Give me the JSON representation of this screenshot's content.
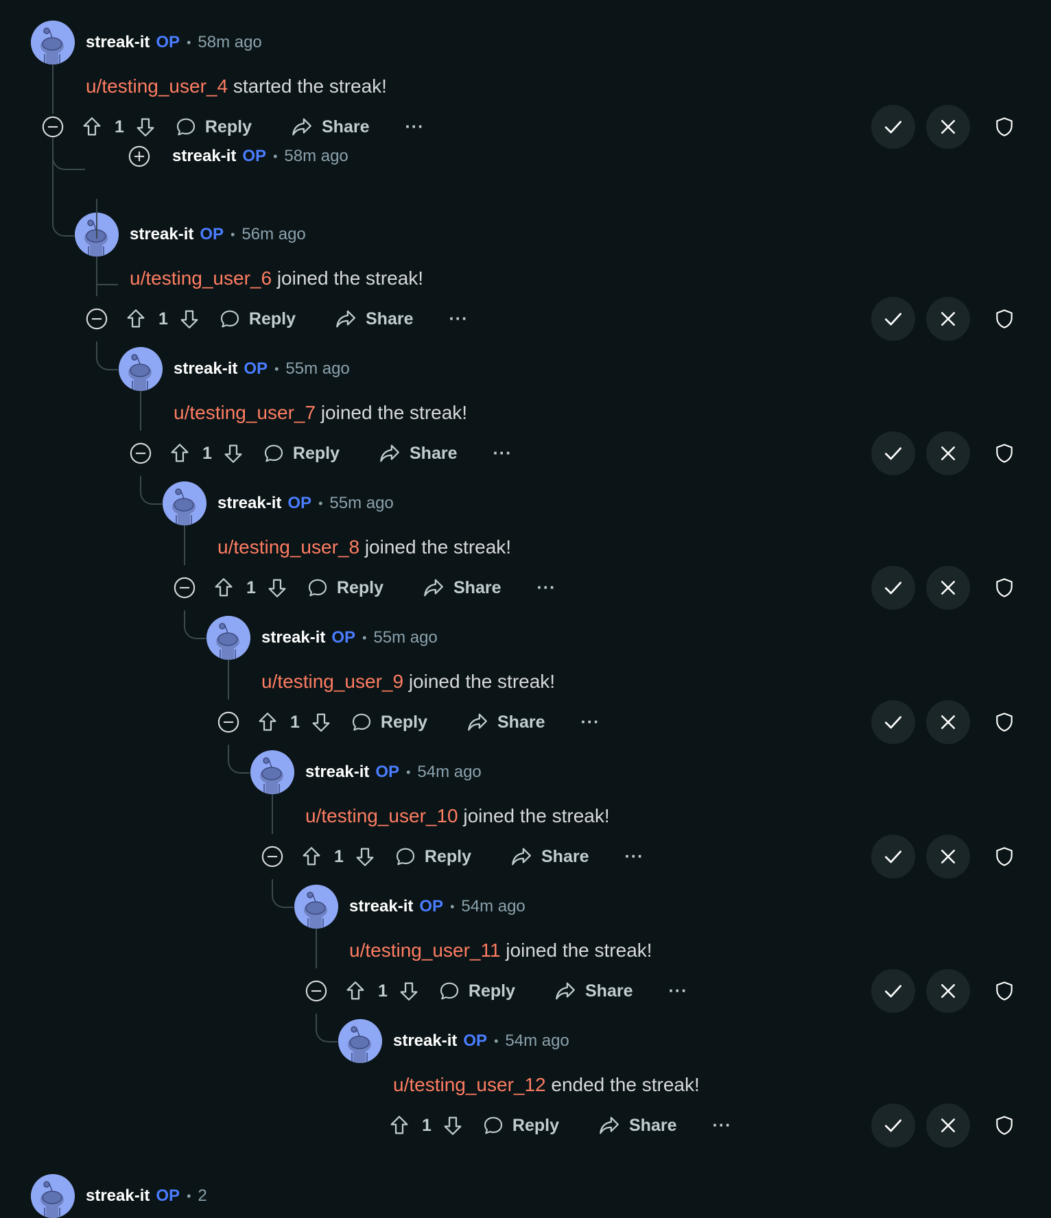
{
  "comments": [
    {
      "author": "streak-it",
      "badge": "OP",
      "time": "58m ago",
      "mention": "u/testing_user_4",
      "text": " started the streak!",
      "votes": "1"
    },
    {
      "author": "streak-it",
      "badge": "OP",
      "time": "58m ago",
      "collapsed": true
    },
    {
      "author": "streak-it",
      "badge": "OP",
      "time": "56m ago",
      "mention": "u/testing_user_6",
      "text": " joined the streak!",
      "votes": "1"
    },
    {
      "author": "streak-it",
      "badge": "OP",
      "time": "55m ago",
      "mention": "u/testing_user_7",
      "text": " joined the streak!",
      "votes": "1"
    },
    {
      "author": "streak-it",
      "badge": "OP",
      "time": "55m ago",
      "mention": "u/testing_user_8",
      "text": " joined the streak!",
      "votes": "1"
    },
    {
      "author": "streak-it",
      "badge": "OP",
      "time": "55m ago",
      "mention": "u/testing_user_9",
      "text": " joined the streak!",
      "votes": "1"
    },
    {
      "author": "streak-it",
      "badge": "OP",
      "time": "54m ago",
      "mention": "u/testing_user_10",
      "text": " joined the streak!",
      "votes": "1"
    },
    {
      "author": "streak-it",
      "badge": "OP",
      "time": "54m ago",
      "mention": "u/testing_user_11",
      "text": " joined the streak!",
      "votes": "1"
    },
    {
      "author": "streak-it",
      "badge": "OP",
      "time": "54m ago",
      "mention": "u/testing_user_12",
      "text": " ended the streak!",
      "votes": "1"
    }
  ],
  "actions": {
    "reply": "Reply",
    "share": "Share",
    "more": "···"
  },
  "partial_next": {
    "author": "streak-it",
    "badge": "OP",
    "time": "2"
  },
  "colors": {
    "background": "#0b1416",
    "mention": "#ff7d63",
    "op_badge": "#4a7dff",
    "avatar": "#8fa8f5",
    "mod_button": "#1b2628"
  }
}
